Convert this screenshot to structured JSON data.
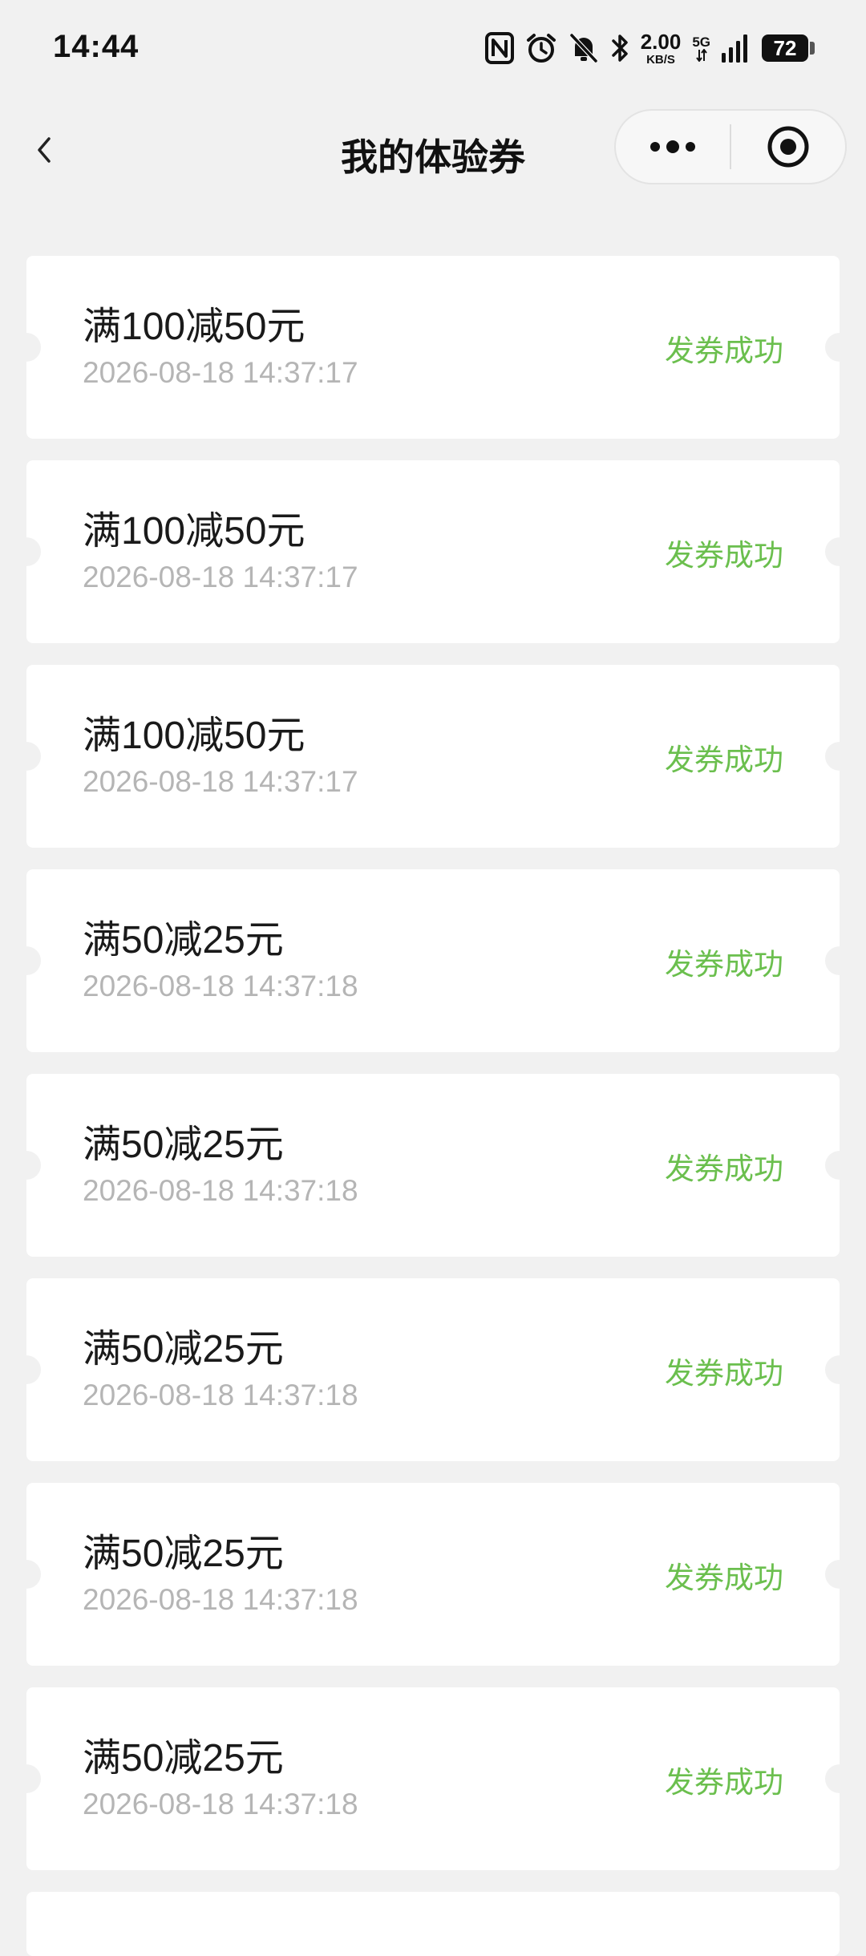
{
  "status_bar": {
    "time": "14:44",
    "net_speed_value": "2.00",
    "net_speed_unit": "KB/S",
    "network_label": "5G",
    "battery": "72",
    "icons": [
      "nfc-icon",
      "alarm-icon",
      "mute-icon",
      "bluetooth-icon",
      "mobile-data-icon",
      "signal-icon",
      "battery-icon"
    ]
  },
  "header": {
    "title": "我的体验券",
    "back_icon": "chevron-left-icon",
    "more_icon": "more-dots-icon",
    "close_icon": "target-circle-icon"
  },
  "colors": {
    "background": "#f1f1f1",
    "card": "#ffffff",
    "status_green": "#6bbf4e",
    "date_gray": "#b5b5b5"
  },
  "coupons": [
    {
      "name": "满100减50元",
      "date": "2026-08-18 14:37:17",
      "status": "发券成功"
    },
    {
      "name": "满100减50元",
      "date": "2026-08-18 14:37:17",
      "status": "发券成功"
    },
    {
      "name": "满100减50元",
      "date": "2026-08-18 14:37:17",
      "status": "发券成功"
    },
    {
      "name": "满50减25元",
      "date": "2026-08-18 14:37:18",
      "status": "发券成功"
    },
    {
      "name": "满50减25元",
      "date": "2026-08-18 14:37:18",
      "status": "发券成功"
    },
    {
      "name": "满50减25元",
      "date": "2026-08-18 14:37:18",
      "status": "发券成功"
    },
    {
      "name": "满50减25元",
      "date": "2026-08-18 14:37:18",
      "status": "发券成功"
    },
    {
      "name": "满50减25元",
      "date": "2026-08-18 14:37:18",
      "status": "发券成功"
    }
  ]
}
